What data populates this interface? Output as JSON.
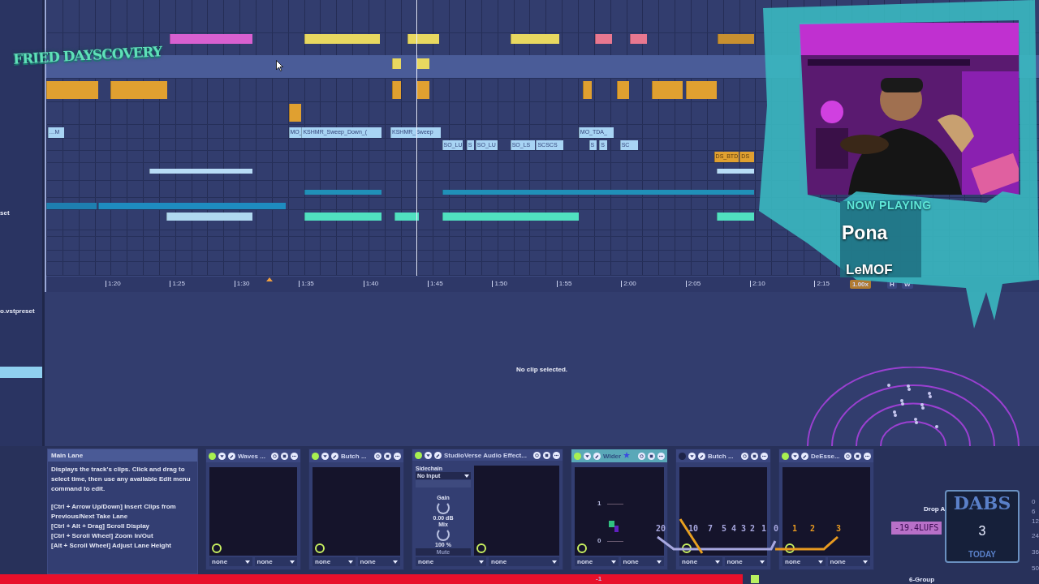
{
  "browser": {
    "items": [
      {
        "label": "set",
        "selected": false
      },
      {
        "label": "o.vstpreset",
        "selected": false
      },
      {
        "selected": true
      }
    ]
  },
  "arrangement": {
    "lanes": [
      {
        "selected": false,
        "clips": [
          {
            "color": "#d860d0"
          },
          {
            "color": "#e8d860"
          },
          {
            "color": "#e8d860"
          },
          {
            "color": "#e8d860"
          },
          {
            "color": "#e87890"
          },
          {
            "color": "#e87890"
          },
          {
            "color": "#c89030"
          }
        ]
      },
      {
        "selected": true,
        "clips": [
          {
            "color": "#e8d860"
          },
          {
            "color": "#e8d860"
          }
        ]
      },
      {
        "selected": false,
        "clips": [
          {
            "color": "#e0a030"
          },
          {
            "color": "#e0a030"
          },
          {
            "color": "#e0a030"
          },
          {
            "color": "#e0a030"
          },
          {
            "color": "#e0a030"
          },
          {
            "color": "#e0a030"
          },
          {
            "color": "#e0a030"
          },
          {
            "color": "#e0a030"
          }
        ]
      },
      {
        "selected": false,
        "clips": [
          {
            "color": "#e0a030"
          }
        ]
      },
      {
        "selected": false,
        "clips": [
          {
            "color": "#a8d4f4",
            "label": "…M"
          },
          {
            "color": "#a8d4f4",
            "label": "MO_"
          },
          {
            "color": "#a8d4f4",
            "label": "KSHMR_Sweep_Down_("
          },
          {
            "color": "#a8d4f4",
            "label": "KSHMR_Sweep"
          },
          {
            "color": "#a8d4f4",
            "label": "MO_TDA_"
          }
        ]
      },
      {
        "selected": false,
        "clips": [
          {
            "color": "#a8d4f4",
            "label": "SO_LU"
          },
          {
            "color": "#a8d4f4",
            "label": "S"
          },
          {
            "color": "#a8d4f4",
            "label": "SO_LU"
          },
          {
            "color": "#a8d4f4",
            "label": "SO_LS"
          },
          {
            "color": "#a8d4f4",
            "label": "SCSCS"
          },
          {
            "color": "#a8d4f4",
            "label": "S"
          },
          {
            "color": "#a8d4f4",
            "label": "S"
          },
          {
            "color": "#a8d4f4",
            "label": "SC"
          }
        ]
      },
      {
        "selected": false,
        "clips": [
          {
            "color": "#e0a030",
            "label": "DS_BTD"
          },
          {
            "color": "#e0a030",
            "label": "DS"
          }
        ]
      },
      {
        "selected": false,
        "clips": [
          {
            "color": "#b8dcf6"
          },
          {
            "color": "#b8dcf6"
          }
        ]
      },
      {
        "selected": false,
        "clips": [
          {
            "color": "#2090b8"
          },
          {
            "color": "#2090b8"
          }
        ]
      },
      {
        "selected": false,
        "clips": [
          {
            "color": "#1e7fb0"
          },
          {
            "color": "#1e8cc0"
          }
        ]
      },
      {
        "selected": false,
        "clips": [
          {
            "color": "#b0d8f0"
          },
          {
            "color": "#50e0c0"
          },
          {
            "color": "#50e0c0"
          },
          {
            "color": "#50e0c0"
          },
          {
            "color": "#50e0c0"
          }
        ]
      }
    ],
    "ruler": [
      "1:20",
      "1:25",
      "1:30",
      "1:35",
      "1:40",
      "1:45",
      "1:50",
      "1:55",
      "2:00",
      "2:05",
      "2:10",
      "2:15"
    ],
    "zoom": "1.00x",
    "view_buttons": [
      "H",
      "W"
    ]
  },
  "detail": {
    "message": "No clip selected."
  },
  "info": {
    "title": "Main Lane",
    "text": "Displays the track's clips. Click and drag to select time, then use any available Edit menu command to edit.",
    "shortcuts": [
      "[Ctrl + Arrow Up/Down] Insert Clips from Previous/Next Take Lane",
      "[Ctrl + Alt + Drag] Scroll Display",
      "[Ctrl + Scroll Wheel] Zoom In/Out",
      "[Alt + Scroll Wheel] Adjust Lane Height"
    ]
  },
  "devices": [
    {
      "kind": "plain",
      "name": "Waves ...",
      "on": true,
      "selected": false,
      "routing": [
        "none",
        "none"
      ]
    },
    {
      "kind": "plain",
      "name": "Butch ...",
      "on": true,
      "selected": false,
      "routing": [
        "none",
        "none"
      ]
    },
    {
      "kind": "studioverse",
      "name": "StudioVerse Audio Effect...",
      "on": true,
      "selected": false,
      "sidechain_label": "Sidechain",
      "sidechain_input": "No Input",
      "gain_label": "Gain",
      "gain": "0.00 dB",
      "mix_label": "Mix",
      "mix": "100 %",
      "mute": "Mute",
      "routing": [
        "none",
        "none"
      ]
    },
    {
      "kind": "wider",
      "name": "Wider",
      "on": true,
      "selected": true,
      "scale": [
        "1",
        "0"
      ],
      "routing": [
        "none",
        "none"
      ]
    },
    {
      "kind": "plain",
      "name": "Butch ...",
      "on": false,
      "selected": false,
      "routing": [
        "none",
        "none"
      ]
    },
    {
      "kind": "plain",
      "name": "DeEsse...",
      "on": true,
      "selected": false,
      "routing": [
        "none",
        "none"
      ]
    }
  ],
  "meter_scale": [
    "0",
    "6",
    "12",
    "24",
    "36",
    "50"
  ],
  "wider_low": "-1",
  "group": "6-Group",
  "overlay": {
    "logo": "FRIED DAYSCOVERY",
    "now_playing": "NOW PLAYING",
    "title": "Pona",
    "artist": "LeMOF",
    "vu_scale": [
      "20",
      "10",
      "7",
      "5",
      "4",
      "3",
      "2",
      "1",
      "0"
    ],
    "vu_red_scale": [
      "1",
      "2",
      "3"
    ],
    "drop": "Drop A",
    "loudness": "-19.4LUFS",
    "badge": {
      "top": "DABS",
      "middle": "3",
      "bottom": "TODAY"
    }
  }
}
